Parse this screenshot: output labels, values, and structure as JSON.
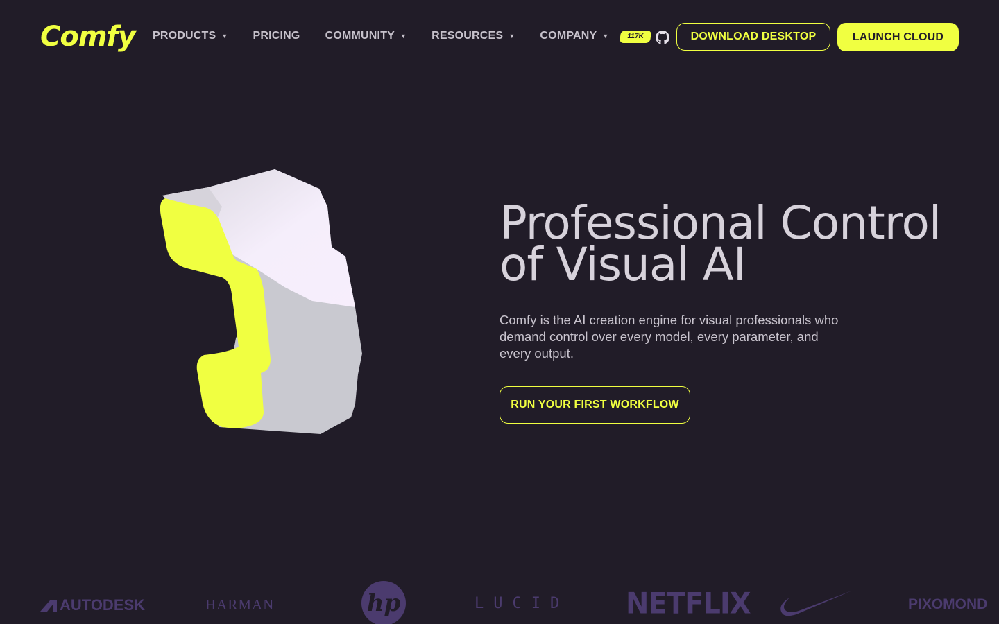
{
  "brand": {
    "logo_text": "Comfy",
    "accent_color": "#f0ff41",
    "background_color": "#211c28"
  },
  "nav": {
    "items": [
      {
        "label": "PRODUCTS",
        "has_dropdown": true
      },
      {
        "label": "PRICING",
        "has_dropdown": false
      },
      {
        "label": "COMMUNITY",
        "has_dropdown": true
      },
      {
        "label": "RESOURCES",
        "has_dropdown": true
      },
      {
        "label": "COMPANY",
        "has_dropdown": true
      }
    ],
    "caret": "▼",
    "github_stars": "117K",
    "github_icon": "github-icon",
    "download_label": "DOWNLOAD DESKTOP",
    "launch_label": "LAUNCH CLOUD"
  },
  "hero": {
    "title_line1": "Professional Control",
    "title_line2": "of Visual AI",
    "subtitle": "Comfy is the AI creation engine for visual professionals who demand control over every model, every parameter, and every output.",
    "cta_label": "RUN YOUR FIRST WORKFLOW",
    "art_icon": "comfy-3d-logo-illustration"
  },
  "partners": {
    "color": "#4b3b6e",
    "logos": [
      {
        "name": "AUTODESK"
      },
      {
        "name": "HARMAN"
      },
      {
        "name": "hp"
      },
      {
        "name": "LUCID"
      },
      {
        "name": "NETFLIX"
      },
      {
        "name": "nike"
      },
      {
        "name": "PIXOMOND"
      }
    ]
  }
}
